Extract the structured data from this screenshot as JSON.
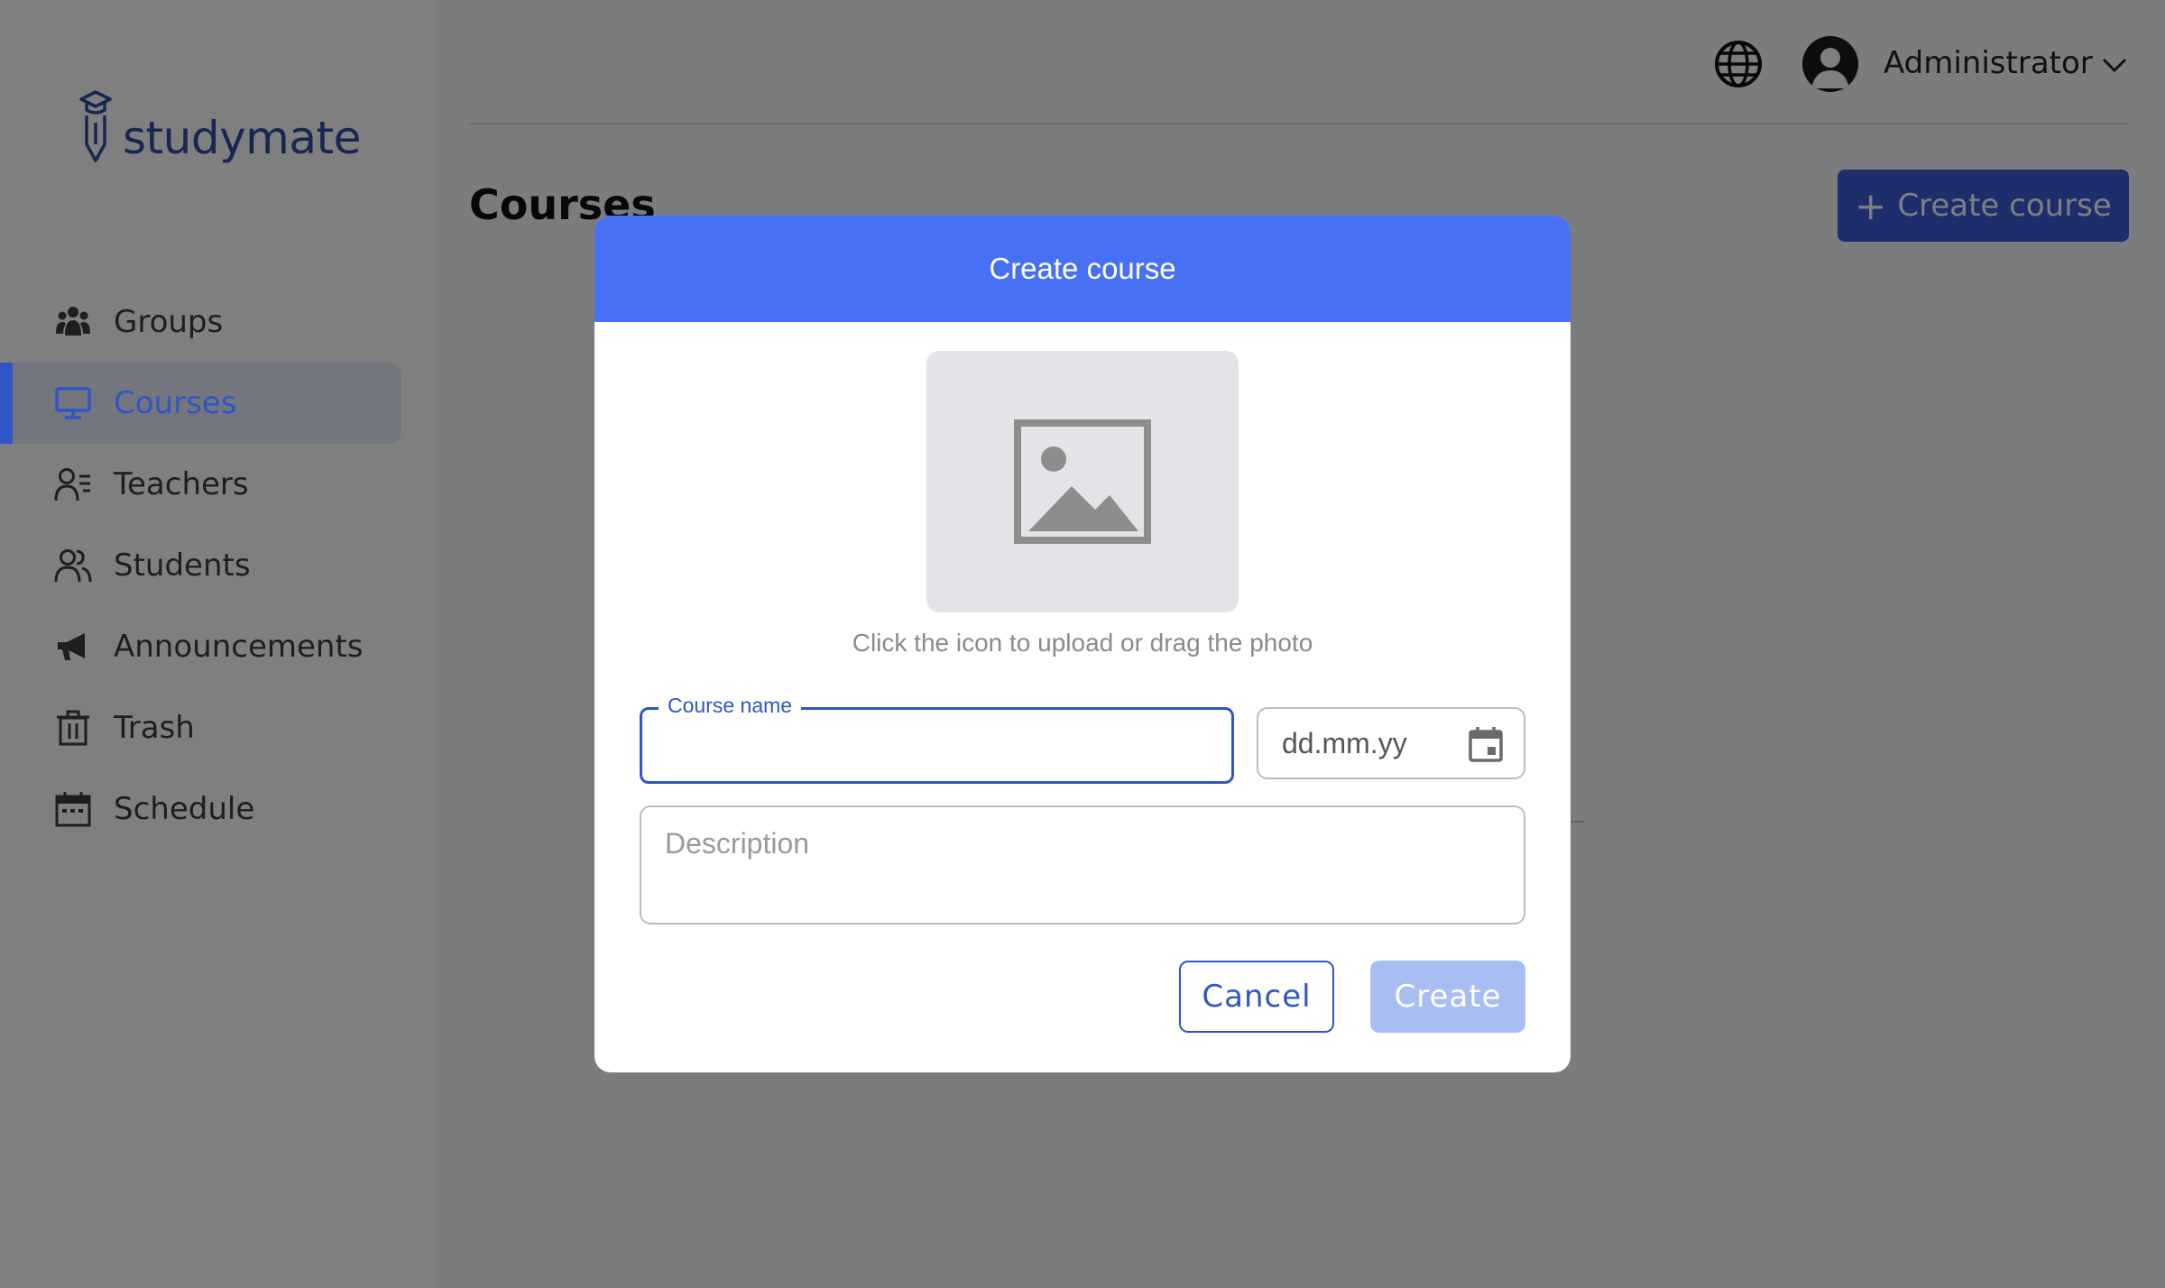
{
  "app": {
    "logo_text": "studymate",
    "brand_color": "#2f4fa3",
    "accent_color": "#4870f5"
  },
  "sidebar": {
    "items": [
      {
        "label": "Groups",
        "icon": "groups-icon",
        "active": false
      },
      {
        "label": "Courses",
        "icon": "monitor-icon",
        "active": true
      },
      {
        "label": "Teachers",
        "icon": "teacher-icon",
        "active": false
      },
      {
        "label": "Students",
        "icon": "students-icon",
        "active": false
      },
      {
        "label": "Announcements",
        "icon": "megaphone-icon",
        "active": false
      },
      {
        "label": "Trash",
        "icon": "trash-icon",
        "active": false
      },
      {
        "label": "Schedule",
        "icon": "calendar-icon",
        "active": false
      }
    ]
  },
  "header": {
    "language_icon": "globe-icon",
    "user_name": "Administrator",
    "user_menu_icon": "chevron-down-icon"
  },
  "page": {
    "title": "Courses",
    "create_button_label": "Create course"
  },
  "modal": {
    "title": "Create course",
    "upload_hint": "Click the icon to upload or drag the photo",
    "course_name_label": "Course name",
    "course_name_value": "",
    "date_placeholder": "dd.mm.yy",
    "description_placeholder": "Description",
    "cancel_label": "Cancel",
    "create_label": "Create"
  }
}
